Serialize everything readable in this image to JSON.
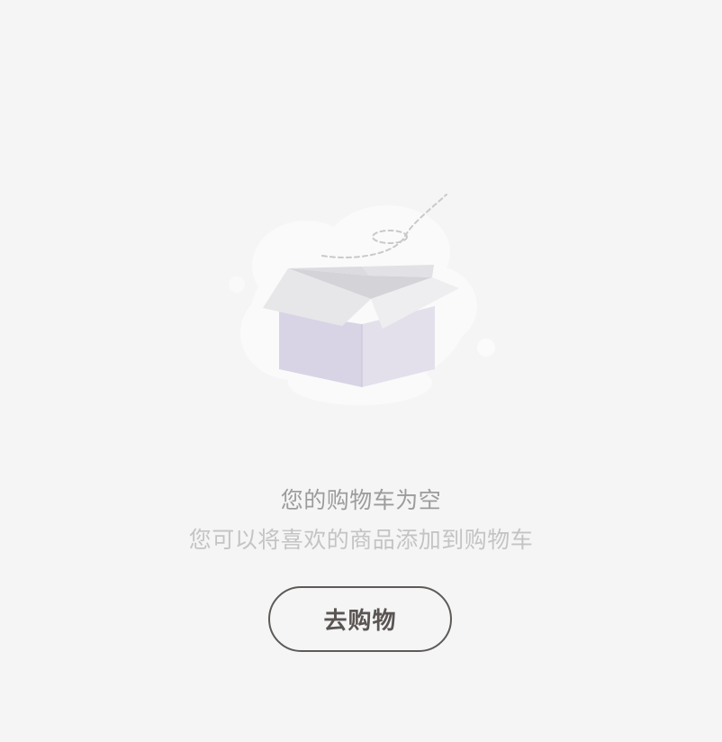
{
  "empty_cart": {
    "illustration_icon": "empty-box-icon",
    "title": "您的购物车为空",
    "subtitle": "您可以将喜欢的商品添加到购物车",
    "button_label": "去购物"
  },
  "colors": {
    "background": "#f5f5f5",
    "title_text": "#9c9c9c",
    "subtitle_text": "#c4c4c4",
    "button_border": "#5e5a58",
    "button_text": "#5a5553",
    "box_body": "#d8d3e6",
    "box_lid": "#e6e6e8"
  }
}
